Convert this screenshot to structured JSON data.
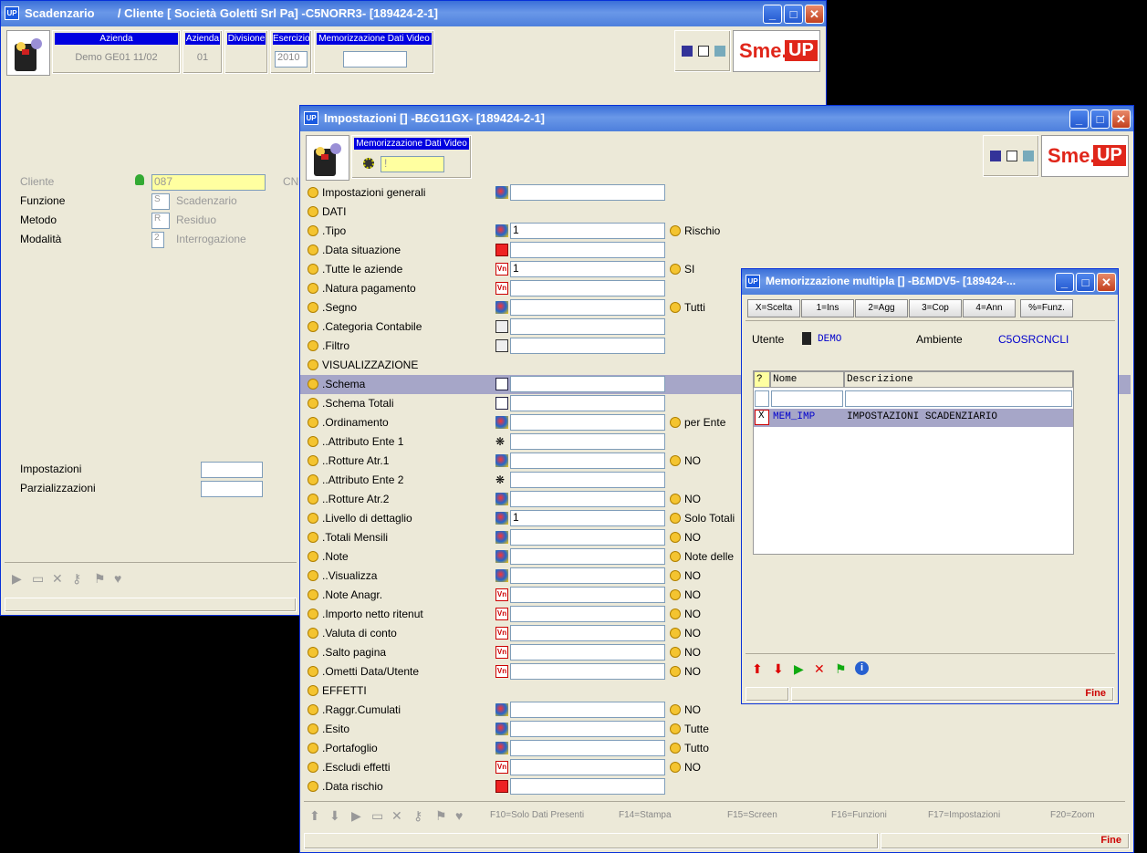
{
  "win1": {
    "title": "Scadenzario",
    "title2": "/ Cliente [ Società Goletti Srl Pa] -C5NORR3- [189424-2-1]",
    "header": {
      "azienda_h": "Azienda",
      "azienda_v": "Demo GE01 11/02",
      "az_h": "Azienda",
      "az_v": "01",
      "div_h": "Divisione",
      "es_h": "Esercizio",
      "es_v": "2010",
      "mem_h": "Memorizzazione Dati Video"
    },
    "cliente_label": "Cliente",
    "cliente_value": "087",
    "cliente_suffix": "CN",
    "funzione_label": "Funzione",
    "funzione_code": "S",
    "funzione_desc": "Scadenzario",
    "metodo_label": "Metodo",
    "metodo_code": "R",
    "metodo_desc": "Residuo",
    "modalita_label": "Modalità",
    "modalita_code": "2",
    "modalita_desc": "Interrogazione",
    "impostazioni_label": "Impostazioni",
    "parzializzazioni_label": "Parzializzazioni"
  },
  "brand": {
    "sme": "Sme.",
    "up": "UP"
  },
  "win2": {
    "title": "Impostazioni [] -B£G11GX- [189424-2-1]",
    "mem_h": "Memorizzazione Dati Video",
    "mem_v": "!",
    "rows": [
      {
        "label": "Impostazioni generali",
        "icon": "ball",
        "value": "",
        "right": ""
      },
      {
        "label": "DATI",
        "icon": "",
        "value": null,
        "right": ""
      },
      {
        "label": ".Tipo",
        "icon": "ball",
        "value": "1",
        "right": "Rischio"
      },
      {
        "label": ".Data situazione",
        "icon": "cal",
        "value": "",
        "right": ""
      },
      {
        "label": ".Tutte le aziende",
        "icon": "vn",
        "value": "1",
        "right": "SI"
      },
      {
        "label": ".Natura pagamento",
        "icon": "vn",
        "value": "",
        "right": ""
      },
      {
        "label": ".Segno",
        "icon": "ball",
        "value": "",
        "right": "Tutti"
      },
      {
        "label": ".Categoria Contabile",
        "icon": "grid",
        "value": "",
        "right": ""
      },
      {
        "label": ".Filtro",
        "icon": "grid",
        "value": "",
        "right": ""
      },
      {
        "label": "VISUALIZZAZIONE",
        "icon": "",
        "value": null,
        "right": ""
      },
      {
        "label": ".Schema",
        "icon": "doc",
        "value": "",
        "right": ""
      },
      {
        "label": ".Schema Totali",
        "icon": "doc",
        "value": "",
        "right": ""
      },
      {
        "label": ".Ordinamento",
        "icon": "ball",
        "value": "",
        "right": "per Ente"
      },
      {
        "label": "..Attributo Ente 1",
        "icon": "paw",
        "value": "",
        "right": ""
      },
      {
        "label": "..Rotture Atr.1",
        "icon": "ball",
        "value": "",
        "right": "NO"
      },
      {
        "label": "..Attributo Ente 2",
        "icon": "paw",
        "value": "",
        "right": ""
      },
      {
        "label": "..Rotture Atr.2",
        "icon": "ball",
        "value": "",
        "right": "NO"
      },
      {
        "label": ".Livello di dettaglio",
        "icon": "ball",
        "value": "1",
        "right": "Solo Totali"
      },
      {
        "label": ".Totali Mensili",
        "icon": "ball",
        "value": "",
        "right": "NO"
      },
      {
        "label": ".Note",
        "icon": "ball",
        "value": "",
        "right": "Note delle"
      },
      {
        "label": "..Visualizza",
        "icon": "ball",
        "value": "",
        "right": "NO"
      },
      {
        "label": ".Note Anagr.",
        "icon": "vn",
        "value": "",
        "right": "NO"
      },
      {
        "label": ".Importo netto ritenut",
        "icon": "vn",
        "value": "",
        "right": "NO"
      },
      {
        "label": ".Valuta di conto",
        "icon": "vn",
        "value": "",
        "right": "NO"
      },
      {
        "label": ".Salto pagina",
        "icon": "vn",
        "value": "",
        "right": "NO"
      },
      {
        "label": ".Ometti Data/Utente",
        "icon": "vn",
        "value": "",
        "right": "NO"
      },
      {
        "label": "EFFETTI",
        "icon": "",
        "value": null,
        "right": ""
      },
      {
        "label": ".Raggr.Cumulati",
        "icon": "ball",
        "value": "",
        "right": "NO"
      },
      {
        "label": ".Esito",
        "icon": "ball",
        "value": "",
        "right": "Tutte"
      },
      {
        "label": ".Portafoglio",
        "icon": "ball",
        "value": "",
        "right": "Tutto"
      },
      {
        "label": ".Escludi effetti",
        "icon": "vn",
        "value": "",
        "right": "NO"
      },
      {
        "label": ".Data rischio",
        "icon": "cal",
        "value": "",
        "right": ""
      }
    ],
    "fkeys": [
      "F10=Solo Dati Presenti",
      "F14=Stampa",
      "F15=Screen",
      "F16=Funzioni",
      "F17=Impostazioni",
      "F20=Zoom"
    ],
    "status": "Fine"
  },
  "win3": {
    "title": "Memorizzazione multipla [] -B£MDV5- [189424-...",
    "buttons": [
      "X=Scelta",
      "1=Ins",
      "2=Agg",
      "3=Cop",
      "4=Ann",
      "%=Funz."
    ],
    "utente_label": "Utente",
    "utente_value": "DEMO",
    "ambiente_label": "Ambiente",
    "ambiente_value": "C5OSRCNCLI",
    "col_q": "?",
    "col_nome": "Nome",
    "col_desc": "Descrizione",
    "row_sel": "X",
    "row_nome": "MEM_IMP",
    "row_desc": "IMPOSTAZIONI SCADENZIARIO",
    "status": "Fine"
  }
}
